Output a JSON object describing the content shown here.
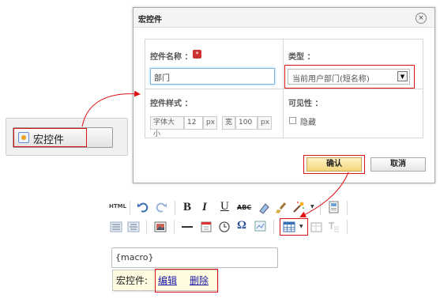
{
  "macro_button": {
    "label": "宏控件"
  },
  "dialog": {
    "title": "宏控件",
    "close_symbol": "×",
    "name_label": "控件名称 ：",
    "required_mark": "*",
    "name_value": "部门",
    "type_label": "类型 ：",
    "type_selected": "当前用户部门(短名称)",
    "style_label": "控件样式 ：",
    "font_size_label": "字体大小",
    "font_size_value": "12",
    "font_size_unit": "px",
    "width_label": "宽",
    "width_value": "100",
    "width_unit": "px",
    "visibility_label": "可见性 ：",
    "hide_label": "隐藏",
    "hide_checked": false,
    "ok_label": "确认",
    "cancel_label": "取消"
  },
  "editor": {
    "toolbar_row1": [
      "HTML",
      "undo-icon",
      "redo-icon",
      "B",
      "I",
      "U",
      "ABC",
      "eraser-icon",
      "brush-icon",
      "magic-wand-icon",
      "template-icon"
    ],
    "toolbar_row2": [
      "justify-left-icon",
      "justify-center-icon",
      "image-icon",
      "horizontal-rule-icon",
      "date-icon",
      "clock-icon",
      "Ω",
      "insert-frame-icon",
      "table-icon",
      "table-props-icon",
      "text-icon"
    ],
    "html_label": "HTML",
    "bold": "B",
    "italic": "I",
    "underline": "U",
    "strike": "ABC",
    "omega": "Ω",
    "content": "{macro}",
    "context_menu": {
      "label": "宏控件:",
      "edit": "编辑",
      "delete": "删除"
    }
  },
  "colors": {
    "highlight": "#dd1111",
    "link": "#1a1aa6",
    "ok_button": "#f3d57c"
  }
}
